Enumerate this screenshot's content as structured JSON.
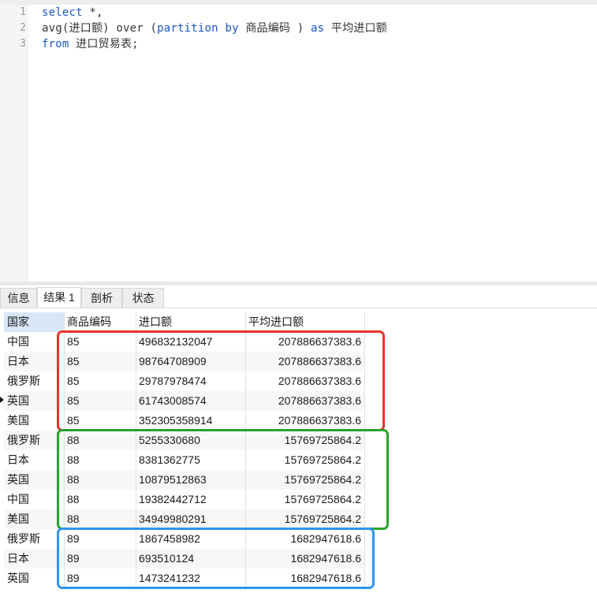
{
  "editor": {
    "line_numbers": [
      "1",
      "2",
      "3"
    ],
    "lines": [
      [
        {
          "t": "select",
          "k": true
        },
        {
          "t": " *,",
          "k": false
        }
      ],
      [
        {
          "t": "avg(进口额) over (",
          "k": false
        },
        {
          "t": "partition by",
          "k": true
        },
        {
          "t": " 商品编码 ) ",
          "k": false
        },
        {
          "t": "as",
          "k": true
        },
        {
          "t": " 平均进口额",
          "k": false
        }
      ],
      [
        {
          "t": "from",
          "k": true
        },
        {
          "t": " 进口贸易表;",
          "k": false
        }
      ]
    ],
    "keyword_color": "#1a56c4"
  },
  "tabs": [
    {
      "label": "信息",
      "active": false
    },
    {
      "label": "结果 1",
      "active": true
    },
    {
      "label": "剖析",
      "active": false
    },
    {
      "label": "状态",
      "active": false
    }
  ],
  "grid": {
    "columns": [
      "国家",
      "商品编码",
      "进口额",
      "平均进口额"
    ],
    "rows": [
      [
        "中国",
        "85",
        "496832132047",
        "207886637383.6"
      ],
      [
        "日本",
        "85",
        "98764708909",
        "207886637383.6"
      ],
      [
        "俄罗斯",
        "85",
        "29787978474",
        "207886637383.6"
      ],
      [
        "英国",
        "85",
        "61743008574",
        "207886637383.6"
      ],
      [
        "美国",
        "85",
        "352305358914",
        "207886637383.6"
      ],
      [
        "俄罗斯",
        "88",
        "5255330680",
        "15769725864.2"
      ],
      [
        "日本",
        "88",
        "8381362775",
        "15769725864.2"
      ],
      [
        "英国",
        "88",
        "10879512863",
        "15769725864.2"
      ],
      [
        "中国",
        "88",
        "19382442712",
        "15769725864.2"
      ],
      [
        "美国",
        "88",
        "34949980291",
        "15769725864.2"
      ],
      [
        "俄罗斯",
        "89",
        "1867458982",
        "1682947618.6"
      ],
      [
        "日本",
        "89",
        "693510124",
        "1682947618.6"
      ],
      [
        "英国",
        "89",
        "1473241232",
        "1682947618.6"
      ]
    ]
  },
  "highlights": [
    {
      "group": "85",
      "color": "#e8342f"
    },
    {
      "group": "88",
      "color": "#27a32b"
    },
    {
      "group": "89",
      "color": "#2f95ee"
    }
  ]
}
